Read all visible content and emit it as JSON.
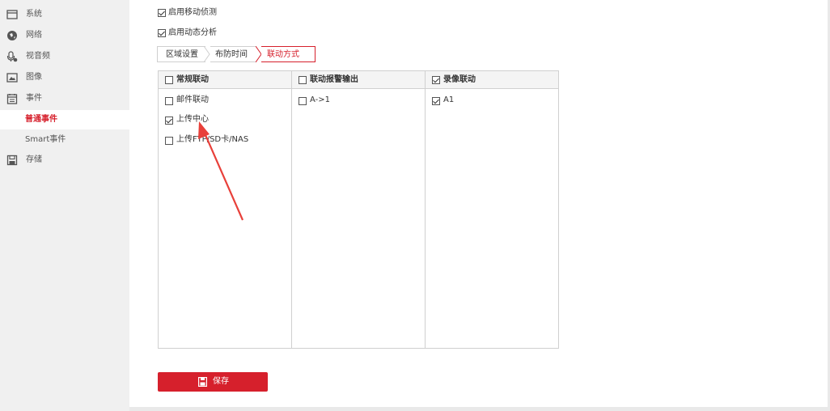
{
  "sidebar": {
    "items": [
      {
        "label": "系统",
        "icon": "window-icon"
      },
      {
        "label": "网络",
        "icon": "globe-icon"
      },
      {
        "label": "视音频",
        "icon": "microphone-icon"
      },
      {
        "label": "图像",
        "icon": "image-icon"
      },
      {
        "label": "事件",
        "icon": "calendar-icon"
      },
      {
        "label": "普通事件",
        "sub": true,
        "active": true
      },
      {
        "label": "Smart事件",
        "sub": true
      },
      {
        "label": "存储",
        "icon": "floppy-icon"
      }
    ]
  },
  "options": {
    "motion_detection": {
      "label": "启用移动侦测",
      "checked": true
    },
    "dynamic_analysis": {
      "label": "启用动态分析",
      "checked": true
    }
  },
  "tabs": [
    {
      "label": "区域设置"
    },
    {
      "label": "布防时间"
    },
    {
      "label": "联动方式",
      "active": true
    }
  ],
  "linkage": {
    "columns": [
      {
        "header": "常规联动",
        "checked": false
      },
      {
        "header": "联动报警输出",
        "checked": false
      },
      {
        "header": "录像联动",
        "checked": true
      }
    ],
    "normal": [
      {
        "label": "邮件联动",
        "checked": false
      },
      {
        "label": "上传中心",
        "checked": true
      },
      {
        "label": "上传FTP/SD卡/NAS",
        "checked": false
      }
    ],
    "alarm_output": [
      {
        "label": "A->1",
        "checked": false
      }
    ],
    "record": [
      {
        "label": "A1",
        "checked": true
      }
    ]
  },
  "save_label": "保存",
  "colors": {
    "accent": "#d6202c",
    "annotation": "#e8403a"
  }
}
